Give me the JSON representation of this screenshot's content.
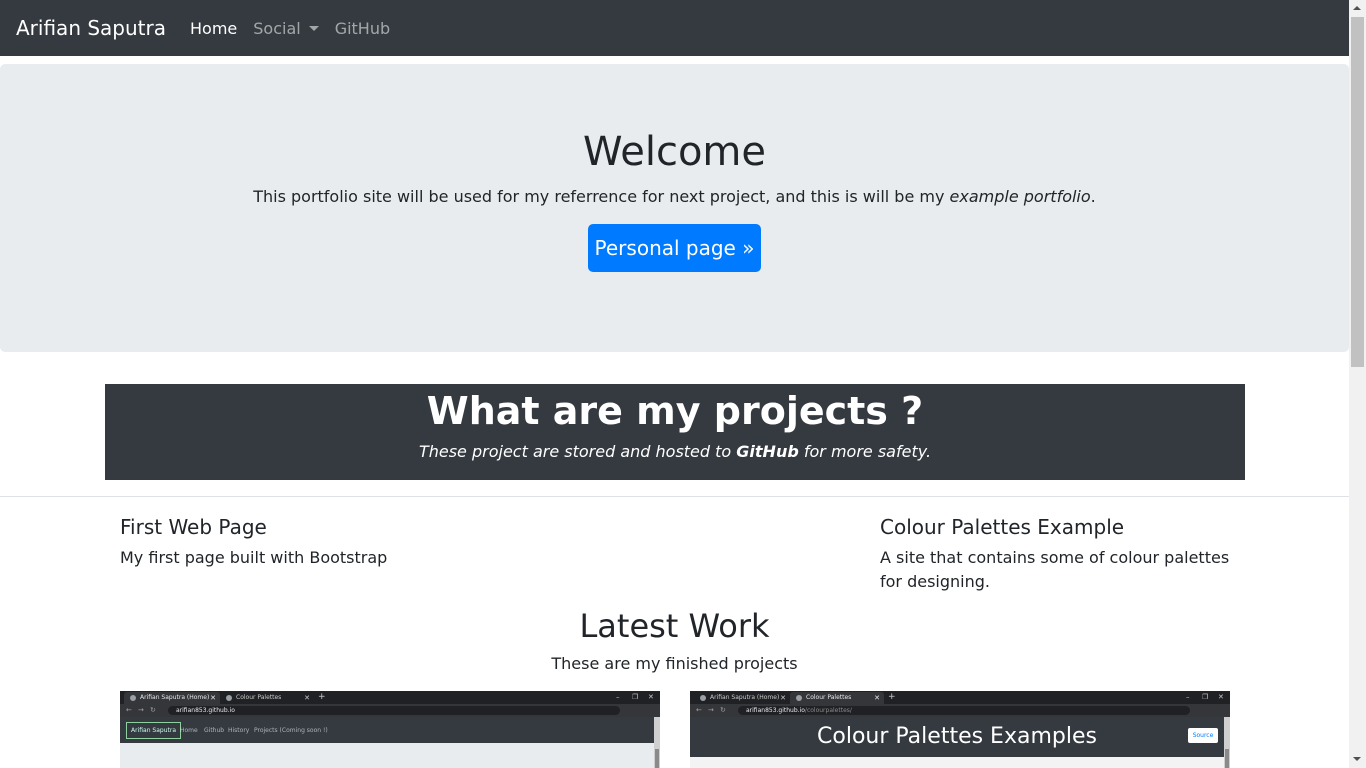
{
  "navbar": {
    "brand": "Arifian Saputra",
    "items": [
      {
        "label": "Home",
        "active": true
      },
      {
        "label": "Social",
        "dropdown": true
      },
      {
        "label": "GitHub"
      }
    ]
  },
  "jumbotron": {
    "title": "Welcome",
    "lead_prefix": "This portfolio site will be used for my referrence for next project, and this is will be my ",
    "lead_emphasis": "example portfolio",
    "lead_suffix": ".",
    "button_label": "Personal page »"
  },
  "projects_banner": {
    "title": "What are my projects ?",
    "subtitle_prefix": "These project are stored and hosted to ",
    "subtitle_bold": "GitHub",
    "subtitle_suffix": " for more safety."
  },
  "projects": [
    {
      "title": "First Web Page",
      "description": "My first page built with Bootstrap"
    },
    {
      "title": "Colour Palettes Example",
      "description": "A site that contains some of colour palettes for designing."
    }
  ],
  "latest_work": {
    "title": "Latest Work",
    "subtitle": "These are my finished projects"
  },
  "thumbnails": [
    {
      "tabs": [
        "Arifian Saputra (Home)",
        "Colour Palettes"
      ],
      "url": "arifian853.github.io",
      "url_path": "",
      "page_brand": "Arifian Saputra",
      "page_nav": [
        "Home",
        "Github",
        "History",
        "Projects (Coming soon !)"
      ]
    },
    {
      "tabs": [
        "Arifian Saputra (Home)",
        "Colour Palettes"
      ],
      "url": "arifian853.github.io",
      "url_path": "/colourpalettes/",
      "page_heading": "Colour Palettes Examples",
      "source_button": "Source"
    }
  ],
  "colors": {
    "navbar_bg": "#343a40",
    "jumbotron_bg": "#e9ecef",
    "primary": "#007bff",
    "text": "#212529"
  }
}
